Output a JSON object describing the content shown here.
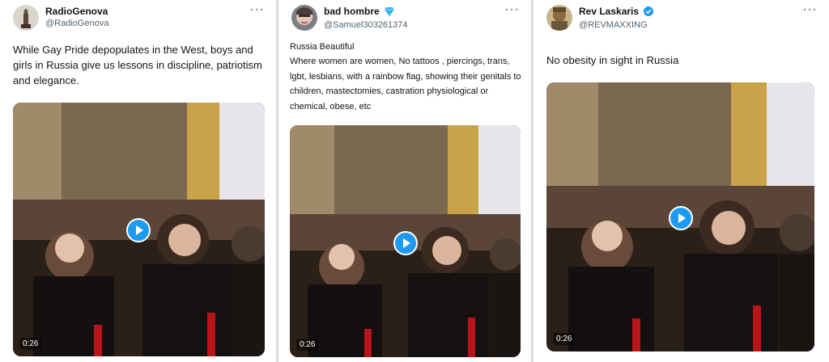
{
  "tweets": [
    {
      "display_name": "RadioGenova",
      "handle": "@RadioGenova",
      "text": "While Gay Pride depopulates in the West, boys and girls in Russia give us lessons in discipline, patriotism and elegance.",
      "video_duration": "0:26",
      "more_icon": "ellipsis-icon"
    },
    {
      "display_name": "bad hombre",
      "badge_icon": "diamond-icon",
      "handle": "@Samuel303261374",
      "text_title": "Russia Beautiful",
      "text": "Where women are women, No tattoos , piercings, trans, lgbt, lesbians, with a rainbow flag, showing their genitals to children, mastectomies, castration physiological or chemical, obese, etc",
      "video_duration": "0:26",
      "more_icon": "ellipsis-icon"
    },
    {
      "display_name": "Rev Laskaris",
      "badge_icon": "verified-icon",
      "handle": "@REVMAXXING",
      "text": "No obesity in sight in Russia",
      "video_duration": "0:26",
      "more_icon": "ellipsis-icon"
    }
  ],
  "colors": {
    "accent": "#1d9bf0",
    "text": "#0f1419",
    "secondary": "#536471"
  }
}
